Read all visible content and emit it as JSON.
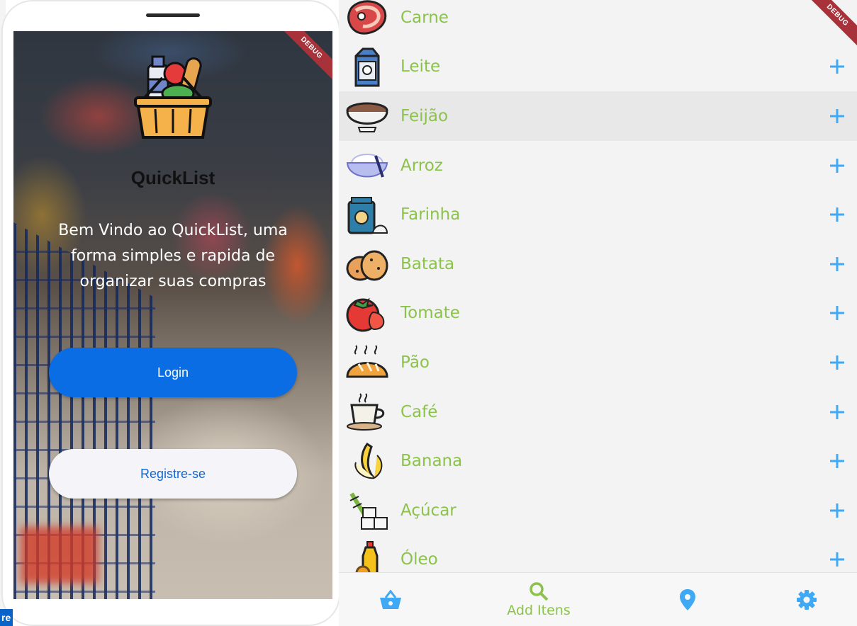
{
  "left": {
    "debug_label": "DEBUG",
    "app_name": "QuickList",
    "welcome_text": "Bem Vindo ao QuickList, uma forma simples e rapida de organizar suas compras",
    "login_label": "Login",
    "register_label": "Registre-se",
    "edge_fragment": "re"
  },
  "right": {
    "debug_label": "DEBUG",
    "items": [
      {
        "label": "Carne",
        "icon": "steak-icon"
      },
      {
        "label": "Leite",
        "icon": "milk-carton-icon"
      },
      {
        "label": "Feijão",
        "icon": "beans-bowl-icon"
      },
      {
        "label": "Arroz",
        "icon": "rice-bowl-icon"
      },
      {
        "label": "Farinha",
        "icon": "flour-sack-icon"
      },
      {
        "label": "Batata",
        "icon": "potato-icon"
      },
      {
        "label": "Tomate",
        "icon": "tomato-icon"
      },
      {
        "label": "Pão",
        "icon": "bread-icon"
      },
      {
        "label": "Café",
        "icon": "coffee-cup-icon"
      },
      {
        "label": "Banana",
        "icon": "banana-icon"
      },
      {
        "label": "Açúcar",
        "icon": "sugar-cane-icon"
      },
      {
        "label": "Óleo",
        "icon": "oil-bottle-icon"
      }
    ],
    "nav": {
      "basket_icon": "basket-icon",
      "search_label": "Add Itens",
      "location_icon": "location-pin-icon",
      "settings_icon": "gear-icon"
    }
  },
  "colors": {
    "accent_green": "#8bc34a",
    "accent_blue": "#3fa9f5",
    "login_blue": "#0a6de3"
  }
}
